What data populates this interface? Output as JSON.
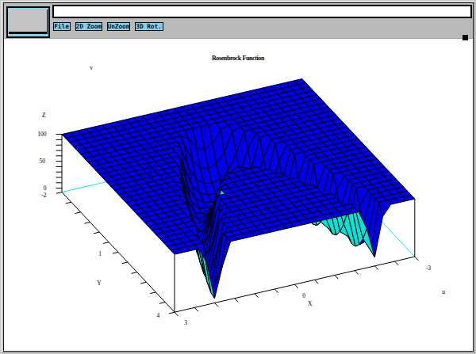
{
  "window": {
    "toolbar": {
      "buttons": [
        {
          "label": "File"
        },
        {
          "label": "2D Zoom"
        },
        {
          "label": "UnZoom"
        },
        {
          "label": "3D Rot."
        }
      ],
      "message_field": {
        "value": "",
        "placeholder": ""
      },
      "status_box": "status-indicator",
      "grip": "pane-resize-grip"
    }
  },
  "chart_data": {
    "type": "surface3d",
    "title": "Rosenbrock Function",
    "function": "z = min(100*(y - x^2)^2 + (1 - x)^2, 100)",
    "x_range": [
      -3,
      3
    ],
    "y_range": [
      -2,
      4
    ],
    "grid_step": 0.2,
    "z_clip": 100,
    "z_ticks": [
      0,
      10,
      20,
      30,
      40,
      50,
      60,
      70,
      80,
      90,
      100
    ],
    "x_tick_step": 0.5,
    "y_tick_step": 0.5,
    "axis_labels": {
      "x": "X",
      "y": "Y",
      "z": "Z",
      "u": "u",
      "v": "v"
    },
    "x_tick_labels": [
      {
        "value": 3,
        "text": "3"
      },
      {
        "value": 0,
        "text": "0"
      },
      {
        "value": -3,
        "text": "-3"
      }
    ],
    "y_tick_labels": [
      {
        "value": -2,
        "text": "-2"
      },
      {
        "value": 1,
        "text": "1"
      },
      {
        "value": 4,
        "text": "4"
      }
    ],
    "z_tick_labels": [
      {
        "value": 0,
        "text": "0"
      },
      {
        "value": 50,
        "text": "50"
      },
      {
        "value": 100,
        "text": "100"
      }
    ],
    "colors": {
      "surface_top": "#0000ee",
      "surface_under": "#00e5d8",
      "mesh_line": "#000000",
      "hidden_edge": "#00eeee",
      "axis_line": "#000000"
    },
    "legend": null,
    "grid": false
  }
}
